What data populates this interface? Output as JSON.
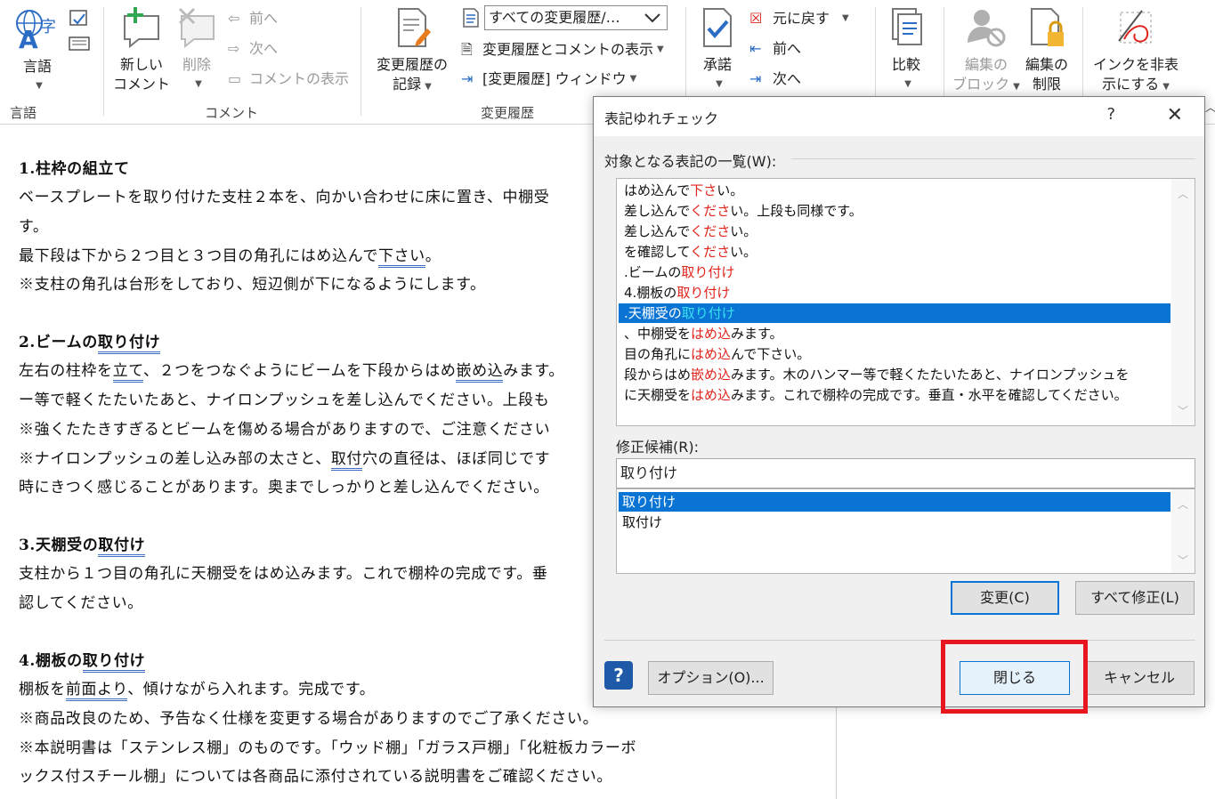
{
  "ribbon": {
    "language": {
      "label": "言語",
      "group": "言語"
    },
    "comment": {
      "new_label_1": "新しい",
      "new_label_2": "コメント",
      "delete_label": "削除",
      "prev": "前へ",
      "next": "次へ",
      "show": "コメントの表示",
      "group": "コメント"
    },
    "tracking": {
      "record_1": "変更履歴の",
      "record_2": "記録",
      "dropdown": "すべての変更履歴/…",
      "show_markup": "変更履歴とコメントの表示",
      "pane": "[変更履歴] ウィンドウ",
      "group": "変更履歴"
    },
    "changes": {
      "accept": "承諾",
      "reject": "元に戻す",
      "prev": "前へ",
      "next": "次へ"
    },
    "compare": {
      "label": "比較"
    },
    "protect": {
      "block_1": "編集の",
      "block_2": "ブロック",
      "restrict_1": "編集の",
      "restrict_2": "制限"
    },
    "ink": {
      "label_1": "インクを非表",
      "label_2": "示にする"
    }
  },
  "document": {
    "p1": "1.柱枠の組立て",
    "p2": "ベースプレートを取り付けた支柱２本を、向かい合わせに床に置き、中棚受",
    "p3": "す。",
    "p4a": "最下段は下から２つ目と３つ目の角孔にはめ込んで",
    "p4b": "下さい",
    "p4c": "。",
    "p5": "※支柱の角孔は台形をしており、短辺側が下になるようにします。",
    "p6a": "2.ビームの",
    "p6b": "取り付け",
    "p7a": "左右の柱枠を",
    "p7b": "立て",
    "p7c": "、２つをつなぐようにビームを下段からはめ",
    "p7d": "嵌め込",
    "p7e": "みます。",
    "p8": "ー等で軽くたたいたあと、ナイロンプッシュを差し込んでください。上段も",
    "p9": "※強くたたきすぎるとビームを傷める場合がありますので、ご注意ください",
    "p10a": "※ナイロンプッシュの差し込み部の太さと、",
    "p10b": "取付",
    "p10c": "穴の直径は、ほぼ同じです",
    "p11": "時にきつく感じることがあります。奥までしっかりと差し込んでください。",
    "p12a": "3.天棚受の",
    "p12b": "取付け",
    "p13": "支柱から１つ目の角孔に天棚受をはめ込みます。これで棚枠の完成です。垂",
    "p14": "認してください。",
    "p15a": "4.棚板の",
    "p15b": "取り付け",
    "p16a": "棚板を",
    "p16b": "前面より",
    "p16c": "、傾けながら入れます。完成です。",
    "p17": "※商品改良のため、予告なく仕様を変更する場合がありますのでご了承ください。",
    "p18": "※本説明書は「ステンレス棚」のものです。「ウッド棚」「ガラス戸棚」「化粧板カラーボ",
    "p19": "ックス付スチール棚」については各商品に添付されている説明書をご確認ください。"
  },
  "dialog": {
    "title": "表記ゆれチェック",
    "help": "?",
    "list_label": "対象となる表記の一覧(W):",
    "items": [
      {
        "a": "はめ込んで",
        "b": "下さ",
        "c": "い。"
      },
      {
        "a": "差し込んで",
        "b": "くださ",
        "c": "い。上段も同様です。"
      },
      {
        "a": "差し込んで",
        "b": "くださ",
        "c": "い。"
      },
      {
        "a": "を確認して",
        "b": "くださ",
        "c": "い。"
      },
      {
        "a": "  .ビームの",
        "b": "取り付け",
        "c": ""
      },
      {
        "a": "  4.棚板の",
        "b": "取り付け",
        "c": ""
      },
      {
        "a": ".天棚受の",
        "b": "取り付け",
        "c": ""
      },
      {
        "a": "、中棚受を",
        "b": "はめ込",
        "c": "みます。"
      },
      {
        "a": "目の角孔に",
        "b": "はめ込",
        "c": "んで下さい。"
      },
      {
        "a": " 段からはめ",
        "b": "嵌め込",
        "c": "みます。木のハンマー等で軽くたたいたあと、ナイロンプッシュを"
      },
      {
        "a": "に天棚受を",
        "b": "はめ込",
        "c": "みます。これで棚枠の完成です。垂直・水平を確認してください。"
      }
    ],
    "candidate_label": "修正候補(R):",
    "candidate_value": "取り付け",
    "candidates": [
      "取り付け",
      "取付け"
    ],
    "change_button": "変更(C)",
    "change_all_button": "すべて修正(L)",
    "options_button": "オプション(O)...",
    "close_button": "閉じる",
    "cancel_button": "キャンセル"
  },
  "colors": {
    "accent": "#0a74d4",
    "highlight_box": "#e8161e",
    "mismatch_text": "#e0241b"
  }
}
